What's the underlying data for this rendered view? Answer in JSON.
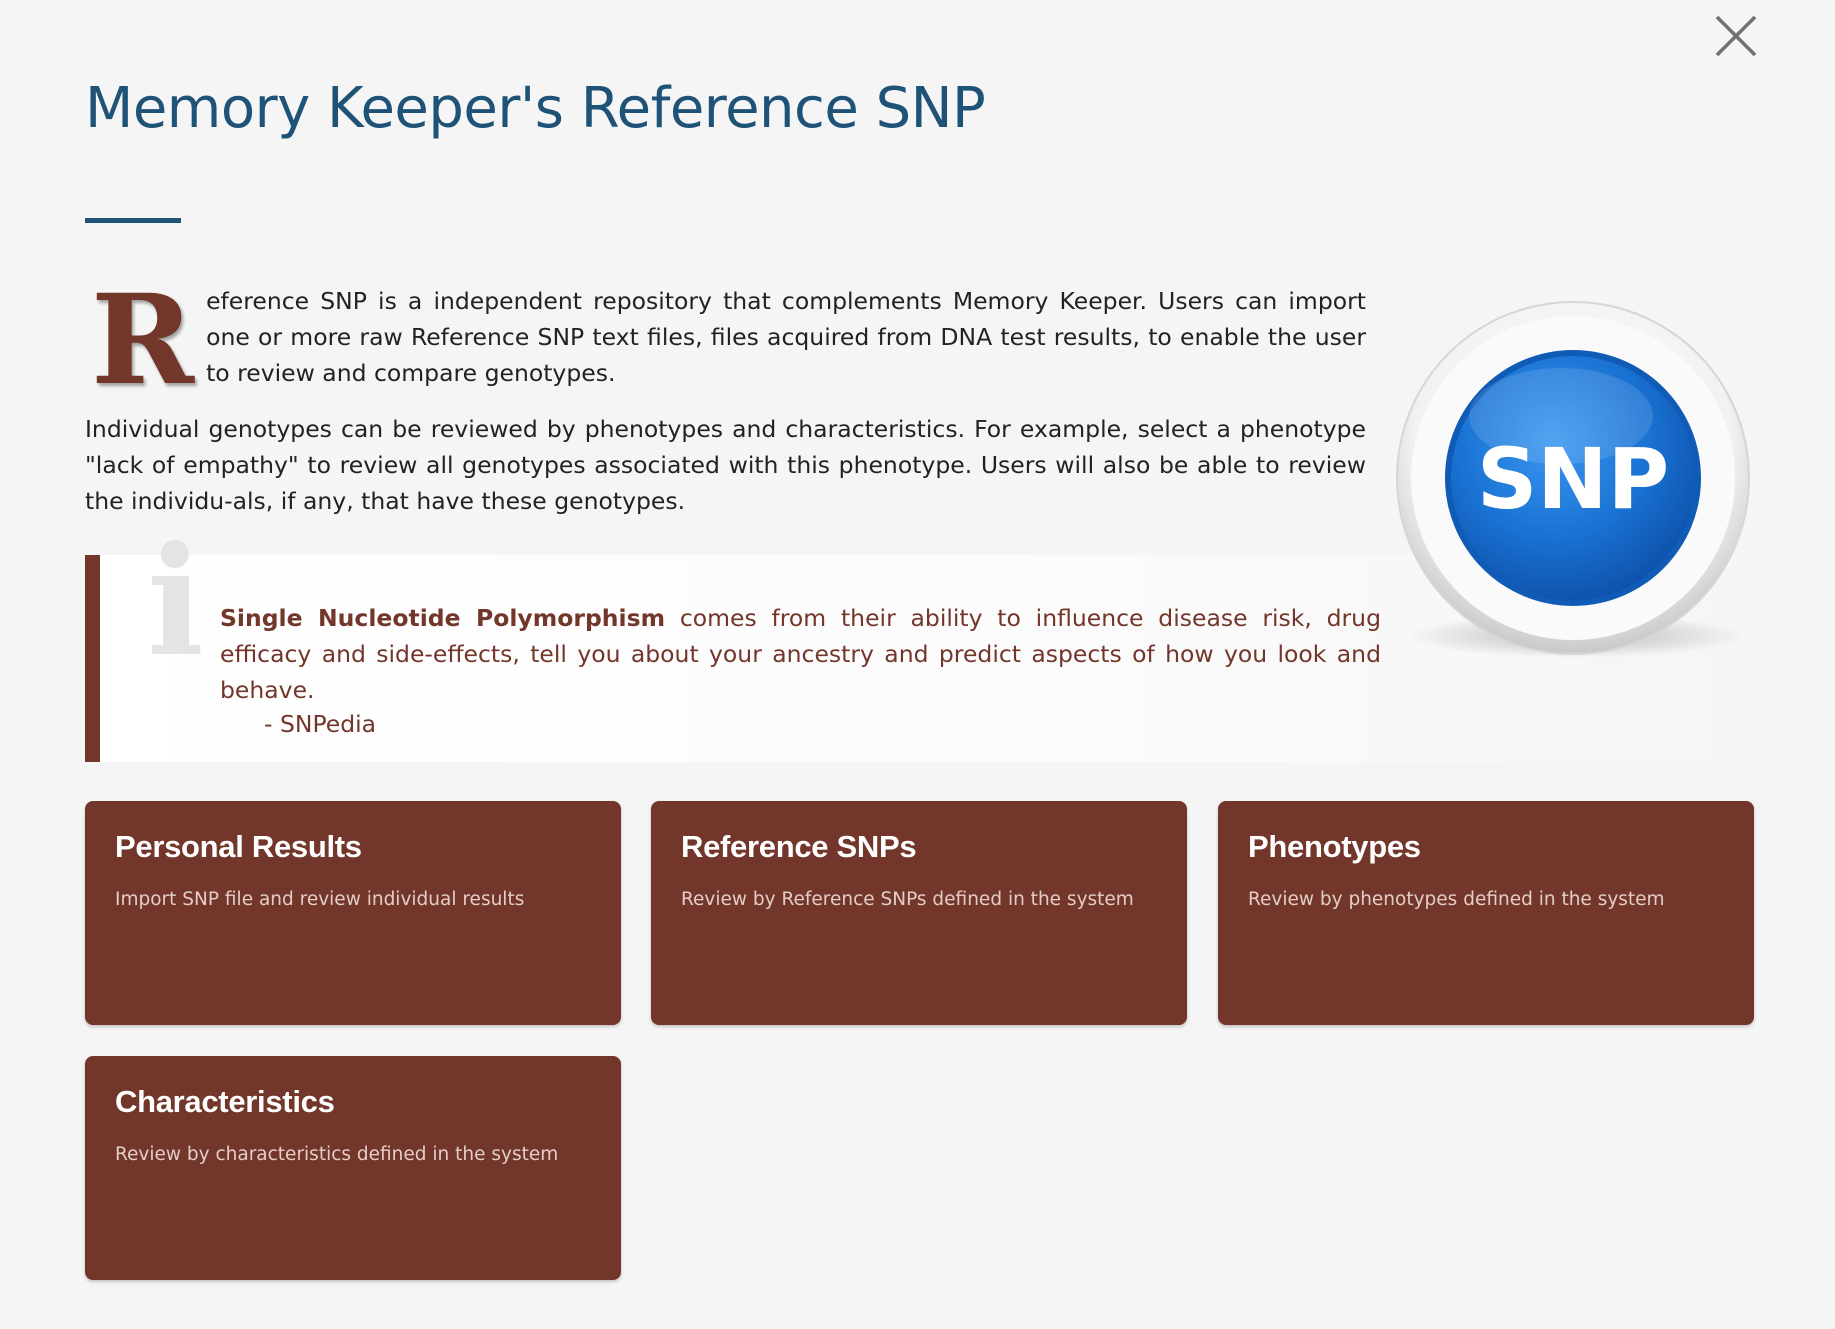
{
  "header": {
    "title": "Memory Keeper's Reference SNP",
    "close_icon": "close-x-icon"
  },
  "intro": {
    "dropcap": "R",
    "paragraph1": "eference SNP is a independent repository that complements Memory Keeper. Users can import one or more raw Reference SNP text files, files acquired from DNA test results, to enable the user to review and compare genotypes.",
    "paragraph2": "Individual genotypes can be reviewed by phenotypes and characteristics. For example, select a phenotype \"lack of empathy\" to review all genotypes associated with this phenotype. Users will also be able to review the individu-als, if any, that have these genotypes."
  },
  "quote": {
    "icon": "info-icon",
    "icon_glyph": "i",
    "highlight": "Single Nucleotide Polymorphism",
    "text": " comes from their ability to influence disease risk, drug efficacy and side-effects, tell you about your ancestry and predict aspects of how you look and behave.",
    "author": "- SNPedia"
  },
  "logo": {
    "icon": "snp-logo",
    "text": "SNP"
  },
  "cards": [
    {
      "title": "Personal Results",
      "description": "Import SNP file and review individual results"
    },
    {
      "title": "Reference SNPs",
      "description": "Review by Reference SNPs defined in the system"
    },
    {
      "title": "Phenotypes",
      "description": "Review by phenotypes defined in the system"
    },
    {
      "title": "Characteristics",
      "description": "Review by characteristics defined in the system"
    }
  ],
  "colors": {
    "title_blue": "#1f5277",
    "brand_brown": "#73362a",
    "background": "#f5f5f5",
    "logo_blue": "#1a73d4"
  }
}
